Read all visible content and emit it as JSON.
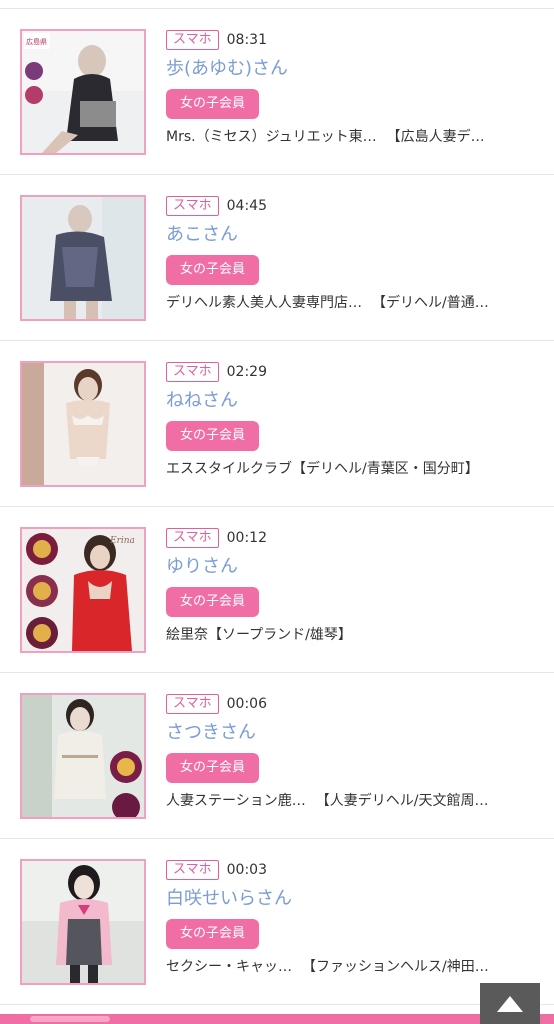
{
  "items": [
    {
      "badge": "スマホ",
      "time": "08:31",
      "name": "歩(あゆむ)さん",
      "member": "女の子会員",
      "shop": "Mrs.（ミセス）ジュリエット東…",
      "category": "【広島人妻デ…",
      "thumb_text": "広島県"
    },
    {
      "badge": "スマホ",
      "time": "04:45",
      "name": "あこさん",
      "member": "女の子会員",
      "shop": "デリヘル素人美人人妻専門店…",
      "category": "【デリヘル/普通…",
      "thumb_text": ""
    },
    {
      "badge": "スマホ",
      "time": "02:29",
      "name": "ねねさん",
      "member": "女の子会員",
      "shop": "エススタイルクラブ",
      "category": "【デリヘル/青葉区・国分町】",
      "thumb_text": ""
    },
    {
      "badge": "スマホ",
      "time": "00:12",
      "name": "ゆりさん",
      "member": "女の子会員",
      "shop": "絵里奈",
      "category": "【ソープランド/雄琴】",
      "thumb_text": "Erina"
    },
    {
      "badge": "スマホ",
      "time": "00:06",
      "name": "さつきさん",
      "member": "女の子会員",
      "shop": "人妻ステーション鹿…",
      "category": "【人妻デリヘル/天文館周…",
      "thumb_text": ""
    },
    {
      "badge": "スマホ",
      "time": "00:03",
      "name": "白咲せいらさん",
      "member": "女の子会員",
      "shop": "セクシー・キャッ…",
      "category": "【ファッションヘルス/神田…",
      "thumb_text": ""
    }
  ],
  "colors": {
    "badge": "#e0609a",
    "name": "#7a9cd8",
    "member_bg": "#f06ea4",
    "thumb_border": "#f0a0c0"
  },
  "icons": {
    "scroll_top": "triangle-up-icon"
  }
}
